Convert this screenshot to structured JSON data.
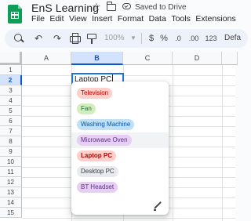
{
  "title": "EnS Learning",
  "save_status": "Saved to Drive",
  "menu": [
    "File",
    "Edit",
    "View",
    "Insert",
    "Format",
    "Data",
    "Tools",
    "Extensions"
  ],
  "toolbar": {
    "zoom": "100%",
    "currency": "$",
    "percent": "%",
    "decrease_decimal": ".0",
    "increase_decimal": ".00",
    "number_format": "123",
    "font": "Defa"
  },
  "columns": [
    "A",
    "B",
    "C",
    "D"
  ],
  "rows": [
    "1",
    "2",
    "3",
    "4",
    "5",
    "6",
    "7",
    "8",
    "9",
    "10",
    "11",
    "12",
    "13",
    "14",
    "15"
  ],
  "active_cell": {
    "value": "Laptop PC"
  },
  "dropdown": {
    "options": [
      {
        "label": "Television",
        "bg": "#ffcfc9",
        "fg": "#b10202"
      },
      {
        "label": "Fan",
        "bg": "#d4edbc",
        "fg": "#11734b"
      },
      {
        "label": "Washing Machine",
        "bg": "#bfe1f6",
        "fg": "#0a53a8"
      },
      {
        "label": "Microwave Oven",
        "bg": "#e6cff2",
        "fg": "#5a3286"
      },
      {
        "label": "Laptop PC",
        "bg": "#ffcfc9",
        "fg": "#b10202"
      },
      {
        "label": "Desktop PC",
        "bg": "#e8eaed",
        "fg": "#3c4043"
      },
      {
        "label": "BT Headset",
        "bg": "#e6cff2",
        "fg": "#5a3286"
      }
    ],
    "hovered_option": "Microwave Oven",
    "bold_option": "Laptop PC"
  },
  "colors": {
    "accent": "#1a73e8",
    "selected_header_bg": "#d3e3fd",
    "toolbar_bg": "#edf2fa"
  }
}
